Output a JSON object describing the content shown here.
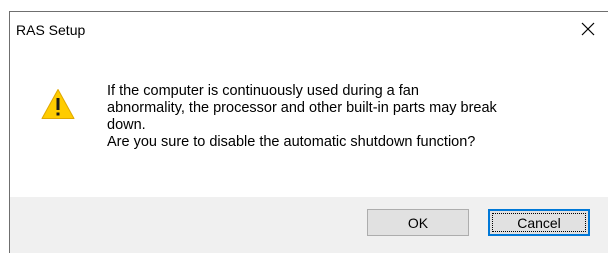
{
  "dialog": {
    "title": "RAS Setup",
    "close_icon": "close-icon",
    "icon": "warning-icon",
    "message_lines": [
      "If the computer is continuously used during a fan",
      "abnormality, the processor and other built-in parts may break",
      "down.",
      "Are you sure to disable the automatic shutdown function?"
    ],
    "buttons": {
      "ok_label": "OK",
      "cancel_label": "Cancel"
    }
  },
  "colors": {
    "accent": "#0078d7",
    "warning_fill": "#ffcc00",
    "footer_bg": "#f0f0f0",
    "button_bg": "#e1e1e1"
  }
}
